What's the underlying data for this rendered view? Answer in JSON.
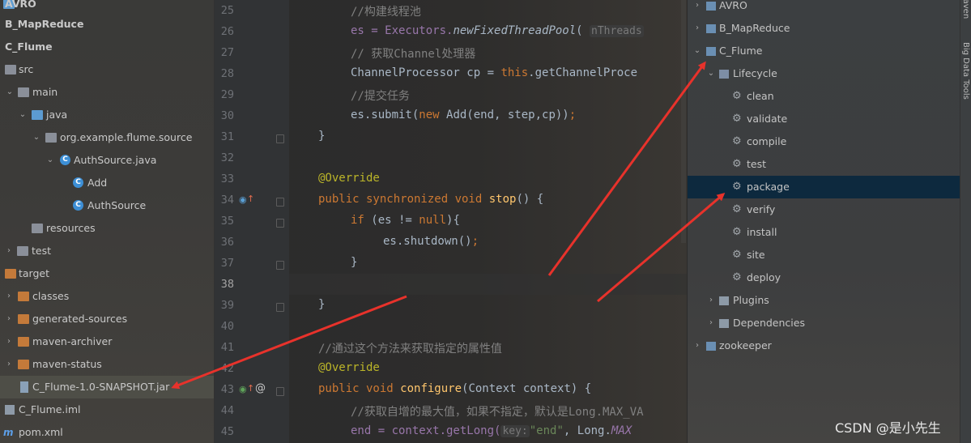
{
  "project_tree": [
    {
      "label": "AVRO",
      "icon": "module-icon",
      "level": 0
    },
    {
      "label": "B_MapReduce",
      "icon": "module-icon",
      "level": 0
    },
    {
      "label": "C_Flume",
      "icon": "module-icon",
      "level": 0
    },
    {
      "label": "src",
      "icon": "folder-icon",
      "level": 1
    },
    {
      "label": "main",
      "icon": "folder-icon",
      "level": 1
    },
    {
      "label": "java",
      "icon": "source-folder-icon",
      "level": 2
    },
    {
      "label": "org.example.flume.source",
      "icon": "package-icon",
      "level": 3
    },
    {
      "label": "AuthSource.java",
      "icon": "java-file-icon",
      "level": 4
    },
    {
      "label": "Add",
      "icon": "class-icon",
      "level": 5
    },
    {
      "label": "AuthSource",
      "icon": "class-icon",
      "level": 5
    },
    {
      "label": "resources",
      "icon": "resources-folder-icon",
      "level": 3
    },
    {
      "label": "test",
      "icon": "folder-icon",
      "level": 2
    },
    {
      "label": "target",
      "icon": "target-folder-icon",
      "level": 0
    },
    {
      "label": "classes",
      "icon": "target-folder-icon",
      "level": 1
    },
    {
      "label": "generated-sources",
      "icon": "target-folder-icon",
      "level": 1
    },
    {
      "label": "maven-archiver",
      "icon": "target-folder-icon",
      "level": 1
    },
    {
      "label": "maven-status",
      "icon": "target-folder-icon",
      "level": 1
    },
    {
      "label": "C_Flume-1.0-SNAPSHOT.jar",
      "icon": "jar-icon",
      "level": 1
    },
    {
      "label": "C_Flume.iml",
      "icon": "iml-icon",
      "level": 0
    },
    {
      "label": "pom.xml",
      "icon": "maven-pom-icon",
      "level": 0
    }
  ],
  "editor": {
    "line_numbers": [
      "25",
      "26",
      "27",
      "28",
      "29",
      "30",
      "31",
      "32",
      "33",
      "34",
      "35",
      "36",
      "37",
      "38",
      "39",
      "40",
      "41",
      "42",
      "43",
      "44",
      "45"
    ],
    "current_line": "38",
    "hints": {
      "nthreads": "nThreads",
      "key": "key:"
    },
    "tokens": {
      "l25_cmt": "//构建线程池",
      "l26_a": "es = Executors.",
      "l26_fn": "newFixedThreadPool",
      "l26_b": "(",
      "l27_cmt": "// 获取Channel处理器",
      "l28_a": "ChannelProcessor cp = ",
      "l28_k": "this",
      "l28_b": ".getChannelProce",
      "l29_cmt": "//提交任务",
      "l30_a": "es.submit(",
      "l30_k": "new",
      "l30_b": " Add(end, step,cp))",
      "l30_c": ";",
      "l31": "}",
      "l33_ann": "@Override",
      "l34_k1": "public synchronized void",
      "l34_fn": "stop",
      "l34_b": "() {",
      "l35_k": "if",
      "l35_a": " (es != ",
      "l35_k2": "null",
      "l35_b": "){",
      "l36_a": "es.shutdown()",
      "l36_c": ";",
      "l37": "}",
      "l39": "}",
      "l41_cmt": "//通过这个方法来获取指定的属性值",
      "l42_ann": "@Override",
      "l43_k": "public void",
      "l43_fn": "configure",
      "l43_b": "(Context context) {",
      "l44_cmt": "//获取自增的最大值，如果不指定，默认是Long.MAX_VA",
      "l45_a": "end = context.getLong(",
      "l45_str": "\"end\"",
      "l45_b": ", Long.",
      "l45_fld": "MAX"
    }
  },
  "maven_tree": [
    {
      "label": "AVRO",
      "icon": "maven-project-icon",
      "expanded": false
    },
    {
      "label": "B_MapReduce",
      "icon": "maven-project-icon",
      "expanded": false
    },
    {
      "label": "C_Flume",
      "icon": "maven-project-icon",
      "expanded": true
    },
    {
      "label": "Lifecycle",
      "icon": "lifecycle-folder-icon",
      "expanded": true
    },
    {
      "label": "clean",
      "icon": "gear-icon"
    },
    {
      "label": "validate",
      "icon": "gear-icon"
    },
    {
      "label": "compile",
      "icon": "gear-icon"
    },
    {
      "label": "test",
      "icon": "gear-icon"
    },
    {
      "label": "package",
      "icon": "gear-icon",
      "selected": true
    },
    {
      "label": "verify",
      "icon": "gear-icon"
    },
    {
      "label": "install",
      "icon": "gear-icon"
    },
    {
      "label": "site",
      "icon": "gear-icon"
    },
    {
      "label": "deploy",
      "icon": "gear-icon"
    },
    {
      "label": "Plugins",
      "icon": "plugins-folder-icon",
      "expanded": false
    },
    {
      "label": "Dependencies",
      "icon": "dependencies-folder-icon",
      "expanded": false
    },
    {
      "label": "zookeeper",
      "icon": "maven-project-icon",
      "expanded": false
    }
  ],
  "right_strip": {
    "maven_tab": "Maven",
    "bigdata_tab": "Big Data Tools"
  },
  "watermark": "CSDN @是小先生",
  "colors": {
    "arrow": "#e8322b",
    "selection": "#0d293e",
    "keyword": "#cc7832",
    "annotation": "#bbb529",
    "method": "#ffc66d",
    "comment": "#808080"
  }
}
